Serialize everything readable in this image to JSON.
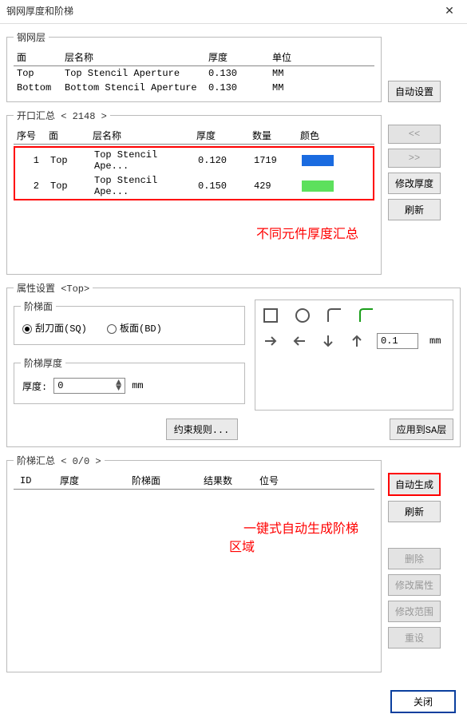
{
  "window": {
    "title": "钢网厚度和阶梯",
    "close": "✕"
  },
  "layer_section": {
    "legend": "钢网层",
    "headers": {
      "side": "面",
      "name": "层名称",
      "thickness": "厚度",
      "unit": "单位"
    },
    "rows": [
      {
        "side": "Top",
        "name": "Top Stencil Aperture",
        "thickness": "0.130",
        "unit": "MM"
      },
      {
        "side": "Bottom",
        "name": "Bottom Stencil Aperture",
        "thickness": "0.130",
        "unit": "MM"
      }
    ],
    "auto_set": "自动设置"
  },
  "aperture_section": {
    "legend": "开口汇总 < 2148 >",
    "headers": {
      "seq": "序号",
      "side": "面",
      "name": "层名称",
      "thickness": "厚度",
      "qty": "数量",
      "color": "颜色"
    },
    "rows": [
      {
        "seq": "1",
        "side": "Top",
        "name": "Top Stencil Ape...",
        "thickness": "0.120",
        "qty": "1719",
        "color": "#1a6be0"
      },
      {
        "seq": "2",
        "side": "Top",
        "name": "Top Stencil Ape...",
        "thickness": "0.150",
        "qty": "429",
        "color": "#5de05d"
      }
    ],
    "annotation": "不同元件厚度汇总",
    "btns": {
      "up": "<<",
      "down": ">>",
      "modify": "修改厚度",
      "refresh": "刷新"
    }
  },
  "attr_section": {
    "legend": "属性设置 <Top>",
    "step_side": {
      "legend": "阶梯面",
      "sq_label": "刮刀面(SQ)",
      "bd_label": "板面(BD)"
    },
    "step_thickness": {
      "legend": "阶梯厚度",
      "label": "厚度:",
      "value": "0",
      "unit": "mm"
    },
    "shape_value": "0.1",
    "shape_unit": "mm",
    "constraint": "约束规则...",
    "apply": "应用到SA层"
  },
  "step_section": {
    "legend": "阶梯汇总 < 0/0 >",
    "headers": {
      "id": "ID",
      "thickness": "厚度",
      "side": "阶梯面",
      "results": "结果数",
      "posno": "位号"
    },
    "annotation1": "一键式自动生成阶梯",
    "annotation2": "区域",
    "btns": {
      "autogen": "自动生成",
      "refresh": "刷新",
      "delete": "删除",
      "modify_attr": "修改属性",
      "modify_range": "修改范围",
      "reset": "重设"
    }
  },
  "footer": {
    "close": "关闭"
  }
}
